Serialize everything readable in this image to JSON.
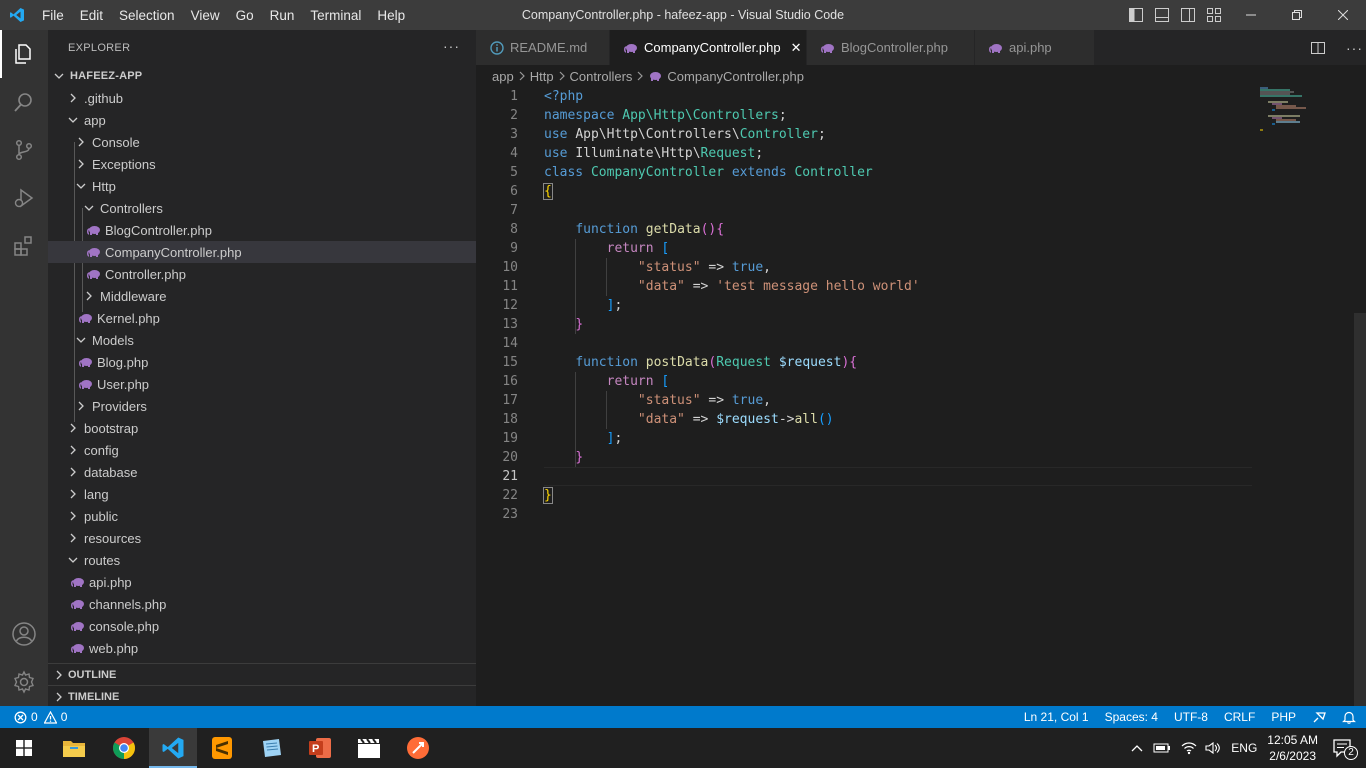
{
  "window": {
    "title": "CompanyController.php - hafeez-app - Visual Studio Code",
    "menu": [
      "File",
      "Edit",
      "Selection",
      "View",
      "Go",
      "Run",
      "Terminal",
      "Help"
    ]
  },
  "sidebar": {
    "header": "EXPLORER",
    "more": "···",
    "root": "HAFEEZ-APP",
    "items": [
      {
        "label": ".github"
      },
      {
        "label": "app"
      },
      {
        "label": "Console"
      },
      {
        "label": "Exceptions"
      },
      {
        "label": "Http"
      },
      {
        "label": "Controllers"
      },
      {
        "label": "BlogController.php"
      },
      {
        "label": "CompanyController.php"
      },
      {
        "label": "Controller.php"
      },
      {
        "label": "Middleware"
      },
      {
        "label": "Kernel.php"
      },
      {
        "label": "Models"
      },
      {
        "label": "Blog.php"
      },
      {
        "label": "User.php"
      },
      {
        "label": "Providers"
      },
      {
        "label": "bootstrap"
      },
      {
        "label": "config"
      },
      {
        "label": "database"
      },
      {
        "label": "lang"
      },
      {
        "label": "public"
      },
      {
        "label": "resources"
      },
      {
        "label": "routes"
      },
      {
        "label": "api.php"
      },
      {
        "label": "channels.php"
      },
      {
        "label": "console.php"
      },
      {
        "label": "web.php"
      }
    ],
    "outline": "OUTLINE",
    "timeline": "TIMELINE"
  },
  "tabs": [
    {
      "label": "README.md"
    },
    {
      "label": "CompanyController.php",
      "close": "✕"
    },
    {
      "label": "BlogController.php"
    },
    {
      "label": "api.php"
    }
  ],
  "breadcrumb": [
    "app",
    "Http",
    "Controllers",
    "CompanyController.php"
  ],
  "editor": {
    "line_numbers": [
      "1",
      "2",
      "3",
      "4",
      "5",
      "6",
      "7",
      "8",
      "9",
      "10",
      "11",
      "12",
      "13",
      "14",
      "15",
      "16",
      "17",
      "18",
      "19",
      "20",
      "21",
      "22",
      "23"
    ],
    "tokens": {
      "l1": "<?php",
      "l2_kw": "namespace",
      "l2_ns": "App\\Http\\Controllers",
      "l3_kw": "use",
      "l3_a": "App\\Http\\Controllers\\",
      "l3_b": "Controller",
      "l4_kw": "use",
      "l4_a": "Illuminate\\Http\\",
      "l4_b": "Request",
      "l5_kw": "class",
      "l5_cls": "CompanyController",
      "l5_ext": "extends",
      "l5_base": "Controller",
      "l6": "{",
      "l8_kw": "function",
      "l8_fn": "getData",
      "l8_pr": "()",
      "l8_br": "{",
      "l9_kw": "return",
      "l9_br": "[",
      "l10_k": "\"status\"",
      "l10_op": " => ",
      "l10_v": "true",
      "l11_k": "\"data\"",
      "l11_op": " => ",
      "l11_v": "'test message hello world'",
      "l12_br": "]",
      "l13": "}",
      "l15_kw": "function",
      "l15_fn": "postData",
      "l15_po": "(",
      "l15_ty": "Request",
      "l15_var": "$request",
      "l15_pc": ")",
      "l15_br": "{",
      "l16_kw": "return",
      "l16_br": "[",
      "l17_k": "\"status\"",
      "l17_op": " => ",
      "l17_v": "true",
      "l18_k": "\"data\"",
      "l18_op": " => ",
      "l18_var": "$request",
      "l18_arrow": "->",
      "l18_fn": "all",
      "l18_pr": "()",
      "l19_br": "]",
      "l20": "}",
      "l22": "}"
    }
  },
  "status": {
    "errors": "0",
    "warnings": "0",
    "position": "Ln 21, Col 1",
    "spaces": "Spaces: 4",
    "encoding": "UTF-8",
    "eol": "CRLF",
    "language": "PHP"
  },
  "taskbar": {
    "lang": "ENG",
    "time": "12:05 AM",
    "date": "2/6/2023",
    "notifications": "2"
  },
  "colors": {
    "accent": "#007acc",
    "php_icon": "#a074c4"
  }
}
